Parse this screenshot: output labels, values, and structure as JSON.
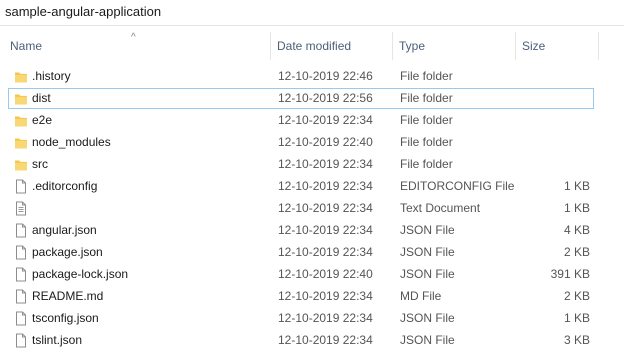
{
  "address_bar": {
    "path": "sample-angular-application"
  },
  "columns": {
    "name": "Name",
    "date_modified": "Date modified",
    "type": "Type",
    "size": "Size"
  },
  "sort_arrow": "^",
  "files": [
    {
      "name": ".history",
      "date": "12-10-2019 22:46",
      "type": "File folder",
      "size": "",
      "icon": "folder-icon"
    },
    {
      "name": "dist",
      "date": "12-10-2019 22:56",
      "type": "File folder",
      "size": "",
      "icon": "folder-icon",
      "selected": true
    },
    {
      "name": "e2e",
      "date": "12-10-2019 22:34",
      "type": "File folder",
      "size": "",
      "icon": "folder-icon"
    },
    {
      "name": "node_modules",
      "date": "12-10-2019 22:40",
      "type": "File folder",
      "size": "",
      "icon": "folder-icon"
    },
    {
      "name": "src",
      "date": "12-10-2019 22:34",
      "type": "File folder",
      "size": "",
      "icon": "folder-icon"
    },
    {
      "name": ".editorconfig",
      "date": "12-10-2019 22:34",
      "type": "EDITORCONFIG File",
      "size": "1 KB",
      "icon": "file-icon"
    },
    {
      "name": "",
      "date": "12-10-2019 22:34",
      "type": "Text Document",
      "size": "1 KB",
      "icon": "text-document-icon"
    },
    {
      "name": "angular.json",
      "date": "12-10-2019 22:34",
      "type": "JSON File",
      "size": "4 KB",
      "icon": "file-icon"
    },
    {
      "name": "package.json",
      "date": "12-10-2019 22:34",
      "type": "JSON File",
      "size": "2 KB",
      "icon": "file-icon"
    },
    {
      "name": "package-lock.json",
      "date": "12-10-2019 22:40",
      "type": "JSON File",
      "size": "391 KB",
      "icon": "file-icon"
    },
    {
      "name": "README.md",
      "date": "12-10-2019 22:34",
      "type": "MD File",
      "size": "2 KB",
      "icon": "file-icon"
    },
    {
      "name": "tsconfig.json",
      "date": "12-10-2019 22:34",
      "type": "JSON File",
      "size": "1 KB",
      "icon": "file-icon"
    },
    {
      "name": "tslint.json",
      "date": "12-10-2019 22:34",
      "type": "JSON File",
      "size": "3 KB",
      "icon": "file-icon"
    }
  ],
  "colors": {
    "folder": "#f4c64a",
    "selection_border": "#99c9ef",
    "header_text": "#4c607a"
  }
}
